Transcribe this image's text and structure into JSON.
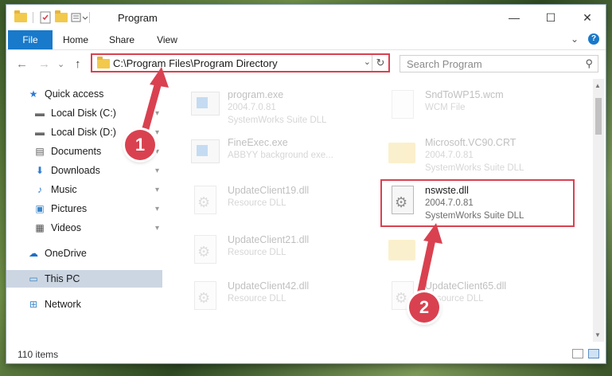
{
  "window": {
    "title": "Program",
    "caption": {
      "minimize": "—",
      "maximize": "☐",
      "close": "✕"
    }
  },
  "ribbon": {
    "tabs": [
      "File",
      "Home",
      "Share",
      "View"
    ],
    "expand": "⌄",
    "help": "?"
  },
  "nav": {
    "back": "←",
    "forward": "→",
    "history": "⌄",
    "up": "↑",
    "address": "C:\\Program Files\\Program Directory",
    "dropdown": "⌄",
    "refresh": "↻",
    "search_placeholder": "Search Program",
    "search_icon": "⚲"
  },
  "sidebar": {
    "items": [
      {
        "label": "Quick access",
        "icon": "star-icon",
        "glyph": "★",
        "color": "#2c7bd6"
      },
      {
        "label": "Local Disk (C:)",
        "icon": "drive-icon",
        "glyph": "▬",
        "color": "#6a6a6a"
      },
      {
        "label": "Local Disk (D:)",
        "icon": "drive-icon",
        "glyph": "▬",
        "color": "#6a6a6a"
      },
      {
        "label": "Documents",
        "icon": "documents-icon",
        "glyph": "▤",
        "color": "#5a5a5a"
      },
      {
        "label": "Downloads",
        "icon": "download-icon",
        "glyph": "⬇",
        "color": "#2c7bd6"
      },
      {
        "label": "Music",
        "icon": "music-icon",
        "glyph": "♪",
        "color": "#2c7bd6"
      },
      {
        "label": "Pictures",
        "icon": "pictures-icon",
        "glyph": "▣",
        "color": "#3a86c8"
      },
      {
        "label": "Videos",
        "icon": "videos-icon",
        "glyph": "▦",
        "color": "#4a4a4a"
      },
      {
        "label": "OneDrive",
        "icon": "cloud-icon",
        "glyph": "☁",
        "color": "#1e6fc4"
      },
      {
        "label": "This PC",
        "icon": "computer-icon",
        "glyph": "▭",
        "color": "#3a86c8"
      },
      {
        "label": "Network",
        "icon": "network-icon",
        "glyph": "⊞",
        "color": "#3a86c8"
      }
    ],
    "pin_glyph": "📌"
  },
  "files": [
    {
      "name": "program.exe",
      "line2": "2004.7.0.81",
      "line3": "SystemWorks Suite DLL",
      "kind": "exe"
    },
    {
      "name": "SndToWP15.wcm",
      "line2": "WCM File",
      "line3": "",
      "kind": "blank"
    },
    {
      "name": "FineExec.exe",
      "line2": "ABBYY background exe...",
      "line3": "",
      "kind": "exe"
    },
    {
      "name": "Microsoft.VC90.CRT",
      "line2": "2004.7.0.81",
      "line3": "SystemWorks Suite DLL",
      "kind": "folder"
    },
    {
      "name": "UpdateClient19.dll",
      "line2": "Resource DLL",
      "line3": "",
      "kind": "dll"
    },
    {
      "name": "nswste.dll",
      "line2": "2004.7.0.81",
      "line3": "SystemWorks Suite DLL",
      "kind": "dll"
    },
    {
      "name": "UpdateClient21.dll",
      "line2": "Resource DLL",
      "line3": "",
      "kind": "dll"
    },
    {
      "name": "",
      "line2": "",
      "line3": "",
      "kind": "folder"
    },
    {
      "name": "UpdateClient42.dll",
      "line2": "Resource DLL",
      "line3": "",
      "kind": "dll"
    },
    {
      "name": "UpdateClient65.dll",
      "line2": "Resource DLL",
      "line3": "",
      "kind": "dll"
    }
  ],
  "status": {
    "item_count": "110 items"
  },
  "annotations": {
    "step1": "1",
    "step2": "2",
    "accent": "#d94150"
  }
}
